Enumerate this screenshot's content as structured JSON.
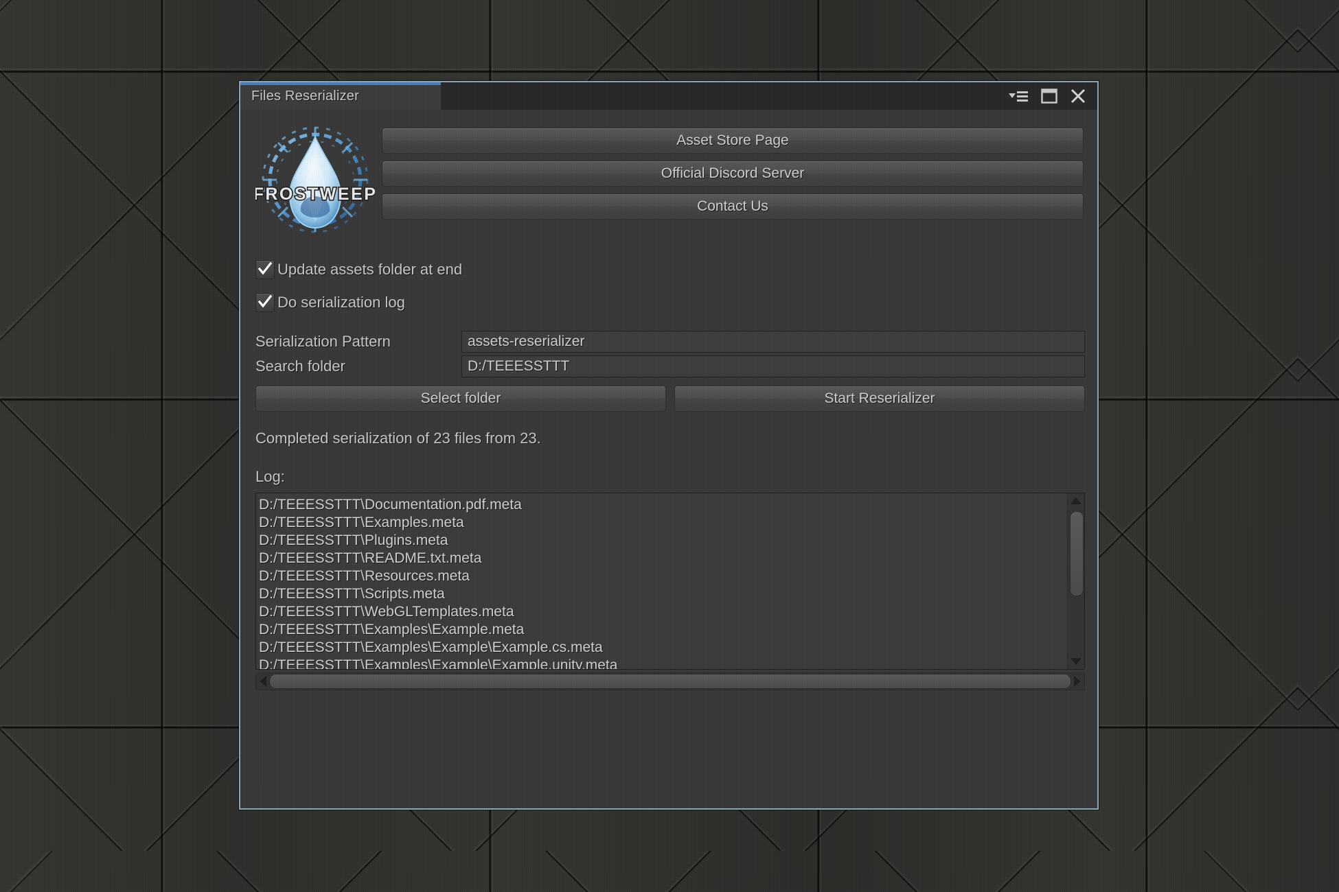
{
  "window": {
    "tab_label": "Files Reserializer",
    "accent_color": "#4a7ebb",
    "border_color": "#8fa5b8",
    "background_color": "#383838",
    "controls": [
      {
        "name": "options-menu-icon",
        "label": "▾☰"
      },
      {
        "name": "maximize-icon",
        "label": "❐"
      },
      {
        "name": "close-icon",
        "label": "✕"
      }
    ]
  },
  "branding": {
    "logo_name": "frostweep-logo",
    "logo_text": "FROSTWEEP",
    "logo_colors": {
      "ice_light": "#dbeefb",
      "ice_mid": "#8fc4e8",
      "ice_dark": "#2f6fa8",
      "ring": "#5ba3dd"
    }
  },
  "links": {
    "asset_store": "Asset Store Page",
    "discord": "Official Discord Server",
    "contact": "Contact Us"
  },
  "options": [
    {
      "label": "Update assets folder at end",
      "checked": true
    },
    {
      "label": "Do serialization log",
      "checked": true
    }
  ],
  "fields": [
    {
      "label": "Serialization Pattern",
      "value": "assets-reserializer",
      "placeholder": ""
    },
    {
      "label": "Search folder",
      "value": "D:/TEEESSTTT",
      "placeholder": ""
    }
  ],
  "actions": {
    "select_folder": "Select folder",
    "start": "Start Reserializer"
  },
  "status": {
    "text": "Completed serialization of 23 files from 23.",
    "files_done": 23,
    "files_total": 23
  },
  "log": {
    "title": "Log:",
    "lines": [
      "D:/TEEESSTTT\\Documentation.pdf.meta",
      "D:/TEEESSTTT\\Examples.meta",
      "D:/TEEESSTTT\\Plugins.meta",
      "D:/TEEESSTTT\\README.txt.meta",
      "D:/TEEESSTTT\\Resources.meta",
      "D:/TEEESSTTT\\Scripts.meta",
      "D:/TEEESSTTT\\WebGLTemplates.meta",
      "D:/TEEESSTTT\\Examples\\Example.meta",
      "D:/TEEESSTTT\\Examples\\Example\\Example.cs.meta",
      "D:/TEEESSTTT\\Examples\\Example\\Example.unity.meta"
    ]
  }
}
